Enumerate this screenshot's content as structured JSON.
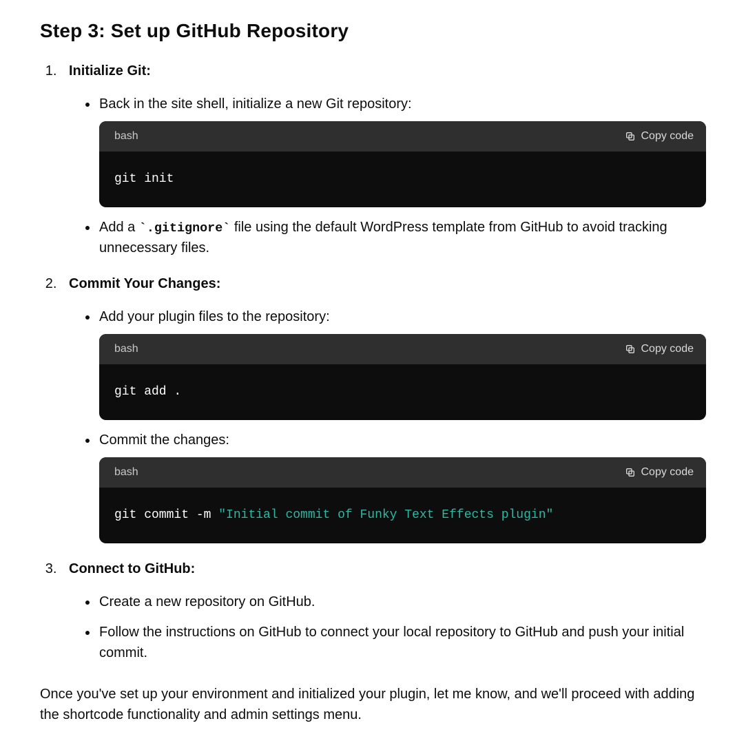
{
  "heading": "Step 3: Set up GitHub Repository",
  "copy_label": "Copy code",
  "items": [
    {
      "title": "Initialize Git:",
      "subs": [
        {
          "text": "Back in the site shell, initialize a new Git repository:",
          "code": {
            "lang": "bash",
            "body": "git init"
          }
        },
        {
          "text_pre": "Add a ",
          "code_inline": "`.gitignore`",
          "text_post": " file using the default WordPress template from GitHub to avoid tracking unnecessary files."
        }
      ]
    },
    {
      "title": "Commit Your Changes:",
      "subs": [
        {
          "text": "Add your plugin files to the repository:",
          "code": {
            "lang": "bash",
            "body": "git add ."
          }
        },
        {
          "text": "Commit the changes:",
          "code": {
            "lang": "bash",
            "body_plain": "git commit -m ",
            "body_string": "\"Initial commit of Funky Text Effects plugin\"",
            "trailing_blank": true
          }
        }
      ]
    },
    {
      "title": "Connect to GitHub:",
      "subs": [
        {
          "text": "Create a new repository on GitHub."
        },
        {
          "text": "Follow the instructions on GitHub to connect your local repository to GitHub and push your initial commit."
        }
      ]
    }
  ],
  "closing": "Once you've set up your environment and initialized your plugin, let me know, and we'll proceed with adding the shortcode functionality and admin settings menu."
}
